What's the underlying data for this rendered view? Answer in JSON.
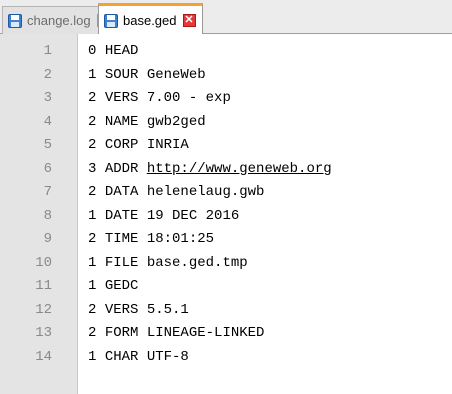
{
  "tabs": [
    {
      "label": "change.log",
      "icon": "save-disk-icon",
      "active": false
    },
    {
      "label": "base.ged",
      "icon": "save-disk-icon",
      "active": true
    }
  ],
  "colors": {
    "active_tab_accent": "#f5a030",
    "close_active": "#e03a3a",
    "disk_icon": "#3c82d6"
  },
  "lines": [
    {
      "num": "1",
      "level": "0",
      "tag": "HEAD",
      "value": ""
    },
    {
      "num": "2",
      "level": "1",
      "tag": "SOUR",
      "value": "GeneWeb"
    },
    {
      "num": "3",
      "level": "2",
      "tag": "VERS",
      "value": "7.00 - exp"
    },
    {
      "num": "4",
      "level": "2",
      "tag": "NAME",
      "value": "gwb2ged"
    },
    {
      "num": "5",
      "level": "2",
      "tag": "CORP",
      "value": "INRIA"
    },
    {
      "num": "6",
      "level": "3",
      "tag": "ADDR",
      "value": "http://www.geneweb.org"
    },
    {
      "num": "7",
      "level": "2",
      "tag": "DATA",
      "value": "helenelaug.gwb"
    },
    {
      "num": "8",
      "level": "1",
      "tag": "DATE",
      "value": "19 DEC 2016"
    },
    {
      "num": "9",
      "level": "2",
      "tag": "TIME",
      "value": "18:01:25"
    },
    {
      "num": "10",
      "level": "1",
      "tag": "FILE",
      "value": "base.ged.tmp"
    },
    {
      "num": "11",
      "level": "1",
      "tag": "GEDC",
      "value": ""
    },
    {
      "num": "12",
      "level": "2",
      "tag": "VERS",
      "value": "5.5.1"
    },
    {
      "num": "13",
      "level": "2",
      "tag": "FORM",
      "value": "LINEAGE-LINKED"
    },
    {
      "num": "14",
      "level": "1",
      "tag": "CHAR",
      "value": "UTF-8"
    }
  ]
}
